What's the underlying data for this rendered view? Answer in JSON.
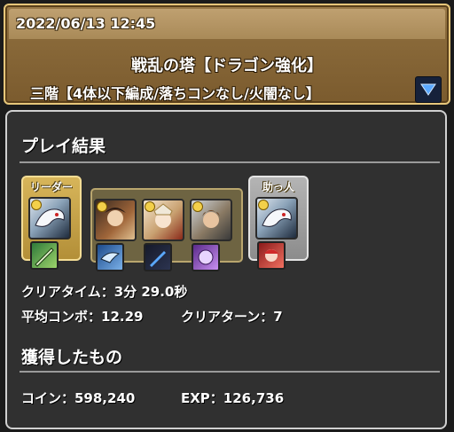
{
  "header": {
    "datetime": "2022/06/13 12:45",
    "dungeon_name": "戦乱の塔【ドラゴン強化】",
    "floor_info": "三階【4体以下編成/落ちコンなし/火闇なし】",
    "toggle_icon": "triangle-down-icon"
  },
  "result": {
    "title": "プレイ結果",
    "leader_label": "リーダー",
    "helper_label": "助っ人",
    "clear_time": "クリアタイム：3分 29.0秒",
    "avg_combo": "平均コンボ：12.29",
    "clear_turns": "クリアターン：7"
  },
  "rewards": {
    "title": "獲得したもの",
    "coins": "コイン：598,240",
    "exp": "EXP：126,736"
  },
  "colors": {
    "leader_gold": "#d7b55a",
    "helper_silver": "#b4b4b4",
    "panel_bg": "#303030",
    "banner_brown": "#8a6a3a",
    "toggle_blue": "#5aa8ff"
  }
}
